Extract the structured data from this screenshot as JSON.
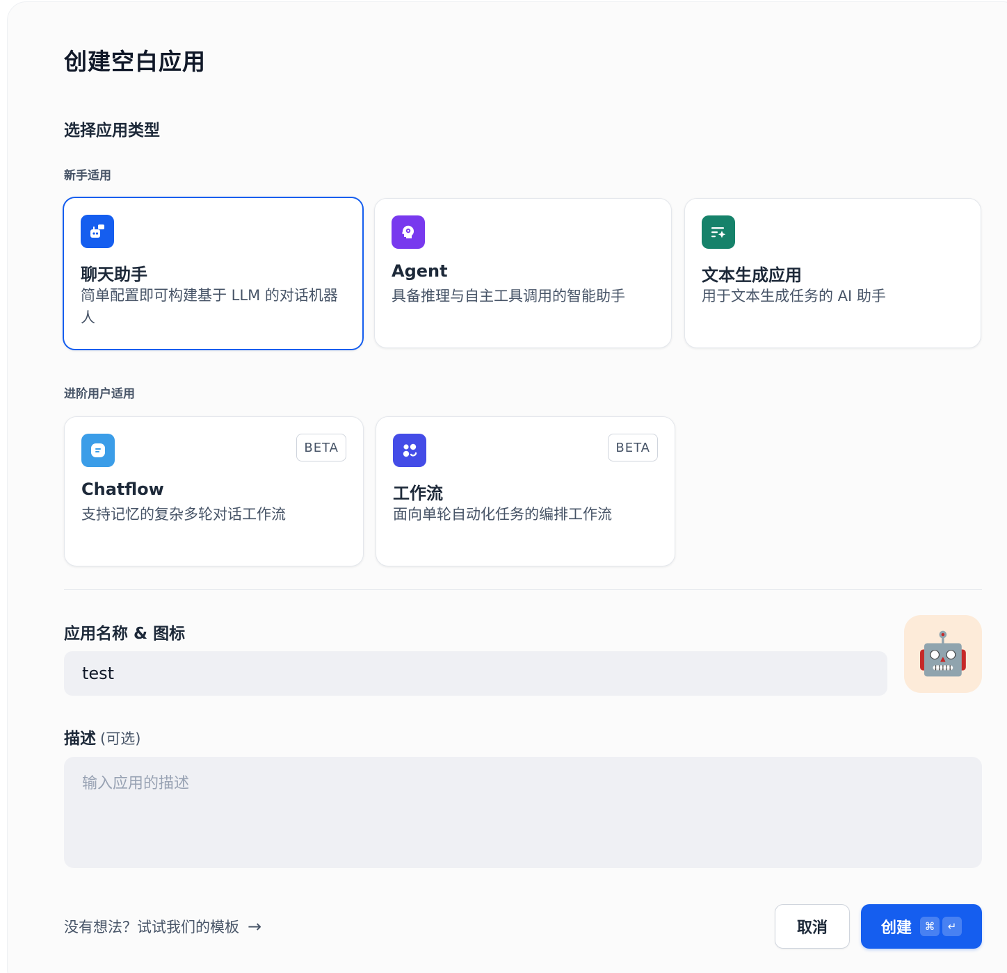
{
  "dialog": {
    "title": "创建空白应用",
    "select_type_label": "选择应用类型"
  },
  "beginner": {
    "label": "新手适用",
    "cards": [
      {
        "title": "聊天助手",
        "desc": "简单配置即可构建基于 LLM 的对话机器人",
        "icon": "chatbot-icon",
        "color": "#155eef",
        "selected": true
      },
      {
        "title": "Agent",
        "desc": "具备推理与自主工具调用的智能助手",
        "icon": "agent-icon",
        "color": "#7839ee",
        "selected": false
      },
      {
        "title": "文本生成应用",
        "desc": "用于文本生成任务的 AI 助手",
        "icon": "text-generation-icon",
        "color": "#16826a",
        "selected": false
      }
    ]
  },
  "advanced": {
    "label": "进阶用户适用",
    "cards": [
      {
        "title": "Chatflow",
        "desc": "支持记忆的复杂多轮对话工作流",
        "badge": "BETA",
        "icon": "chatflow-icon",
        "color": "#3b9de8"
      },
      {
        "title": "工作流",
        "desc": "面向单轮自动化任务的编排工作流",
        "badge": "BETA",
        "icon": "workflow-icon",
        "color": "#444ce7"
      }
    ]
  },
  "name_section": {
    "label": "应用名称 & 图标",
    "value": "test",
    "app_icon": "🤖",
    "app_icon_bg": "#fdebd9"
  },
  "desc_section": {
    "label": "描述",
    "optional": "(可选)",
    "placeholder": "输入应用的描述"
  },
  "footer": {
    "template_link": "没有想法？试试我们的模板",
    "cancel": "取消",
    "create": "创建",
    "kbd_cmd": "⌘",
    "kbd_enter": "↵"
  }
}
